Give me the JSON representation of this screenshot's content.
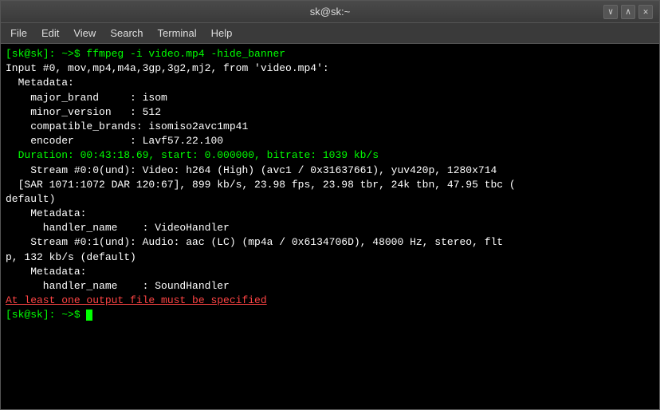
{
  "window": {
    "title": "sk@sk:~",
    "menu": {
      "items": [
        "File",
        "Edit",
        "View",
        "Search",
        "Terminal",
        "Help"
      ]
    }
  },
  "terminal": {
    "lines": [
      {
        "text": "[sk@sk]: ~>$ ffmpeg -i video.mp4 -hide_banner",
        "color": "green"
      },
      {
        "text": "Input #0, mov,mp4,m4a,3gp,3g2,mj2, from 'video.mp4':",
        "color": "white"
      },
      {
        "text": "  Metadata:",
        "color": "white"
      },
      {
        "text": "    major_brand     : isom",
        "color": "white"
      },
      {
        "text": "    minor_version   : 512",
        "color": "white"
      },
      {
        "text": "    compatible_brands: isomiso2avc1mp41",
        "color": "white"
      },
      {
        "text": "    encoder         : Lavf57.22.100",
        "color": "white"
      },
      {
        "text": "  Duration: 00:43:18.69, start: 0.000000, bitrate: 1039 kb/s",
        "color": "green"
      },
      {
        "text": "    Stream #0:0(und): Video: h264 (High) (avc1 / 0x31637661), yuv420p, 1280x714",
        "color": "white"
      },
      {
        "text": "  [SAR 1071:1072 DAR 120:67], 899 kb/s, 23.98 fps, 23.98 tbr, 24k tbn, 47.95 tbc (",
        "color": "white"
      },
      {
        "text": "default)",
        "color": "white"
      },
      {
        "text": "    Metadata:",
        "color": "white"
      },
      {
        "text": "      handler_name    : VideoHandler",
        "color": "white"
      },
      {
        "text": "    Stream #0:1(und): Audio: aac (LC) (mp4a / 0x6134706D), 48000 Hz, stereo, flt",
        "color": "white"
      },
      {
        "text": "p, 132 kb/s (default)",
        "color": "white"
      },
      {
        "text": "    Metadata:",
        "color": "white"
      },
      {
        "text": "      handler_name    : SoundHandler",
        "color": "white"
      },
      {
        "text": "At least one output file must be specified",
        "color": "red"
      },
      {
        "text": "[sk@sk]: ~>$ ",
        "color": "green",
        "has_cursor": true
      }
    ]
  }
}
